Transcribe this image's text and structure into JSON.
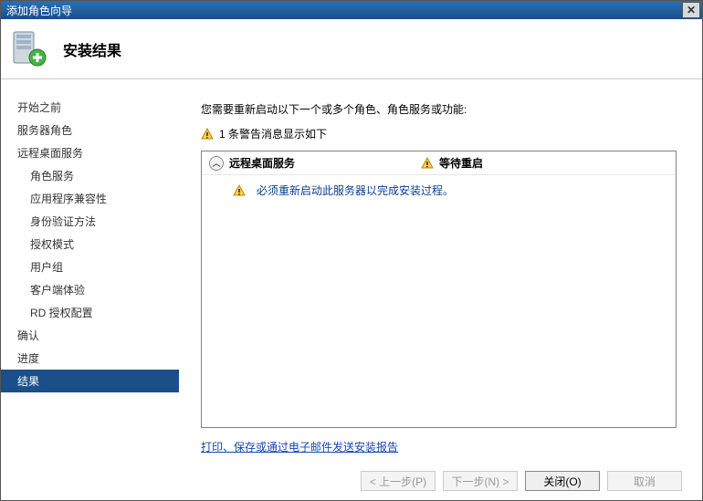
{
  "window": {
    "title": "添加角色向导"
  },
  "header": {
    "title": "安装结果"
  },
  "sidebar": {
    "items": [
      {
        "label": "开始之前",
        "indent": false
      },
      {
        "label": "服务器角色",
        "indent": false
      },
      {
        "label": "远程桌面服务",
        "indent": false
      },
      {
        "label": "角色服务",
        "indent": true
      },
      {
        "label": "应用程序兼容性",
        "indent": true
      },
      {
        "label": "身份验证方法",
        "indent": true
      },
      {
        "label": "授权模式",
        "indent": true
      },
      {
        "label": "用户组",
        "indent": true
      },
      {
        "label": "客户端体验",
        "indent": true
      },
      {
        "label": "RD 授权配置",
        "indent": true
      },
      {
        "label": "确认",
        "indent": false
      },
      {
        "label": "进度",
        "indent": false
      },
      {
        "label": "结果",
        "indent": false,
        "selected": true
      }
    ]
  },
  "content": {
    "intro": "您需要重新启动以下一个或多个角色、角色服务或功能:",
    "warning_summary": "1 条警告消息显示如下",
    "panel": {
      "service": "远程桌面服务",
      "status": "等待重启",
      "message": "必须重新启动此服务器以完成安装过程。"
    },
    "report_link": "打印、保存或通过电子邮件发送安装报告"
  },
  "buttons": {
    "prev": "< 上一步(P)",
    "next": "下一步(N) >",
    "close": "关闭(O)",
    "cancel": "取消"
  }
}
